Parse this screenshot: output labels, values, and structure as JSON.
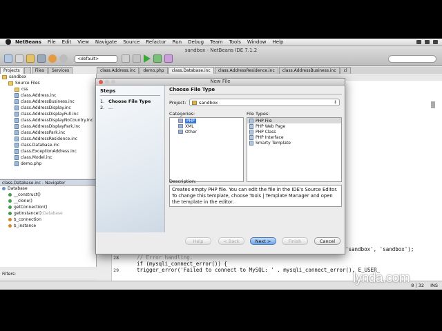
{
  "menubar": {
    "app": "NetBeans",
    "items": [
      "File",
      "Edit",
      "View",
      "Navigate",
      "Source",
      "Refactor",
      "Run",
      "Debug",
      "Team",
      "Tools",
      "Window",
      "Help"
    ]
  },
  "window": {
    "title": "sandbox - NetBeans IDE 7.1.2"
  },
  "toolbar": {
    "config_combo": "<default>"
  },
  "left_tabs": [
    "Projects",
    "Files",
    "Services"
  ],
  "project_tree": [
    {
      "label": "sandbox",
      "type": "project",
      "indent": 0
    },
    {
      "label": "Source Files",
      "type": "folder",
      "indent": 1
    },
    {
      "label": "css",
      "type": "folder",
      "indent": 2
    },
    {
      "label": "class.Address.inc",
      "type": "file",
      "indent": 2
    },
    {
      "label": "class.AddressBusiness.inc",
      "type": "file",
      "indent": 2
    },
    {
      "label": "class.AddressDisplay.inc",
      "type": "file",
      "indent": 2
    },
    {
      "label": "class.AddressDisplayFull.inc",
      "type": "file",
      "indent": 2
    },
    {
      "label": "class.AddressDisplayNoCountry.inc",
      "type": "file",
      "indent": 2
    },
    {
      "label": "class.AddressDisplayPark.inc",
      "type": "file",
      "indent": 2
    },
    {
      "label": "class.AddressPark.inc",
      "type": "file",
      "indent": 2
    },
    {
      "label": "class.AddressResidence.inc",
      "type": "file",
      "indent": 2
    },
    {
      "label": "class.Database.inc",
      "type": "file",
      "indent": 2
    },
    {
      "label": "class.ExceptionAddress.inc",
      "type": "file",
      "indent": 2
    },
    {
      "label": "class.Model.inc",
      "type": "file",
      "indent": 2
    },
    {
      "label": "demo.php",
      "type": "file",
      "indent": 2
    }
  ],
  "navigator": {
    "header": "class.Database.inc - Navigator",
    "items": [
      {
        "label": "Database",
        "indent": 0
      },
      {
        "label": "__construct()",
        "indent": 1
      },
      {
        "label": "__clone()",
        "indent": 1
      },
      {
        "label": "getConnection()",
        "indent": 1
      },
      {
        "label": "getInstance()",
        "extra": ":Database",
        "indent": 1
      },
      {
        "label": "$_connection",
        "indent": 1
      },
      {
        "label": "$_instance",
        "indent": 1
      }
    ],
    "filters_label": "Filters:"
  },
  "editor_tabs": [
    "class.Address.inc",
    "demo.php",
    "class.Database.inc",
    "class.AddressResidence.inc",
    "class.AddressBusiness.inc",
    "cl"
  ],
  "editor": {
    "lines": [
      {
        "n": "",
        "text": "'sandbox', 'sandbox');"
      },
      {
        "n": "28",
        "text": "  // Error handling."
      },
      {
        "n": "",
        "text": "  if (mysqli_connect_error()) {"
      },
      {
        "n": "29",
        "text": "    trigger_error('Failed to connect to MySQL: ' . mysqli_connect_error(), E_USER_"
      }
    ]
  },
  "status": {
    "position": "8 | 32",
    "mode": "INS"
  },
  "dialog": {
    "title": "New File",
    "steps_heading": "Steps",
    "steps": [
      {
        "n": "1.",
        "label": "Choose File Type"
      },
      {
        "n": "2.",
        "label": "..."
      }
    ],
    "heading": "Choose File Type",
    "project_label": "Project:",
    "project_value": "sandbox",
    "categories_label": "Categories:",
    "categories": [
      "PHP",
      "XML",
      "Other"
    ],
    "filetypes_label": "File Types:",
    "filetypes": [
      "PHP File",
      "PHP Web Page",
      "PHP Class",
      "PHP Interface",
      "Smarty Template"
    ],
    "description_label": "Description:",
    "description": "Creates empty PHP file. You can edit the file in the IDE's Source Editor. To change this template, choose Tools | Template Manager and open the template in the editor.",
    "buttons": {
      "help": "Help",
      "back": "< Back",
      "next": "Next >",
      "finish": "Finish",
      "cancel": "Cancel"
    }
  },
  "brand": "lynda.com"
}
